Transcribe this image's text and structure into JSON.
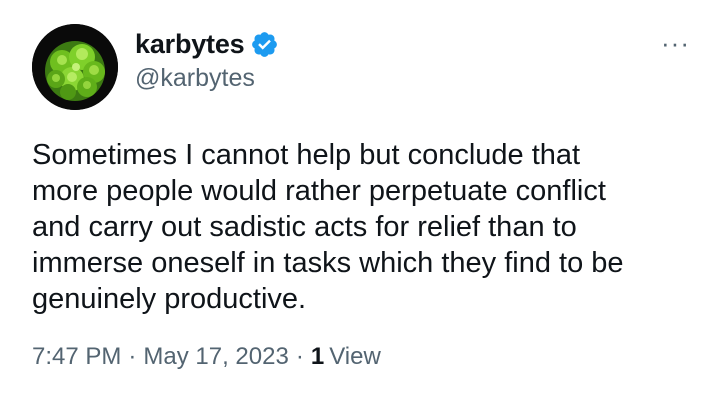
{
  "author": {
    "display_name": "karbytes",
    "handle": "@karbytes",
    "verified": true,
    "verified_color": "#1d9bf0",
    "avatar_icon": "romanesco-broccoli-avatar"
  },
  "menu": {
    "more_icon": "more-options-icon",
    "more_glyph": "···"
  },
  "tweet": {
    "lines": [
      "Sometimes I cannot help but conclude that",
      "more people would rather perpetuate conflict",
      "and carry out sadistic acts for relief than to",
      "immerse oneself in tasks which they find to be",
      "genuinely productive."
    ]
  },
  "meta": {
    "time": "7:47 PM",
    "separator": "·",
    "date": "May 17, 2023",
    "views_count": "1",
    "views_label": "View"
  },
  "colors": {
    "text": "#0f1419",
    "secondary": "#536471",
    "background": "#ffffff"
  }
}
